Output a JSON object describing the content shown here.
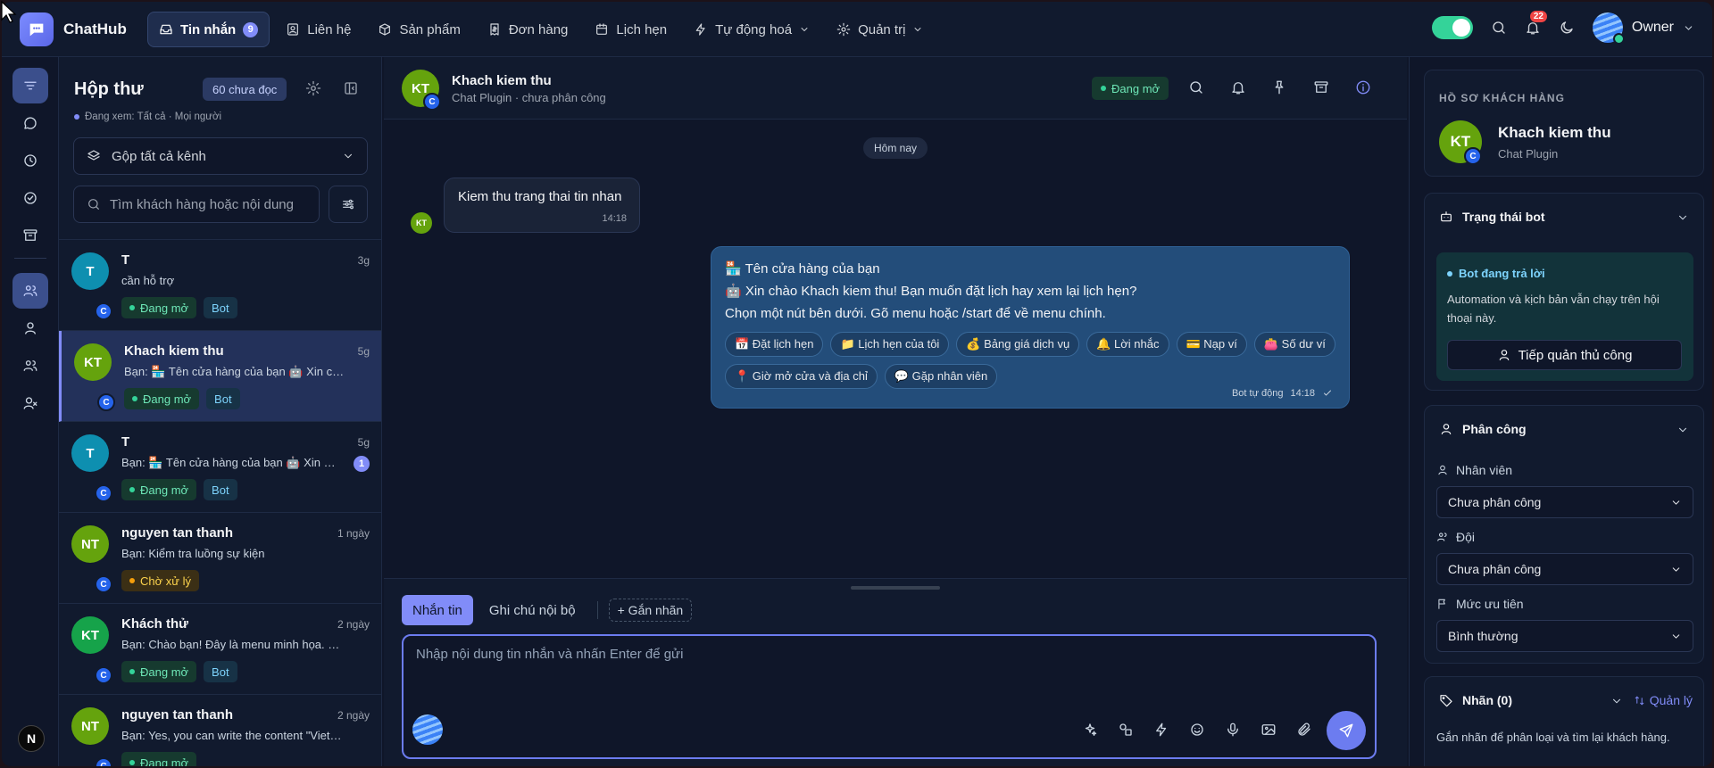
{
  "app": {
    "brand": "ChatHub"
  },
  "nav": {
    "items": [
      {
        "label": "Tin nhắn",
        "badge": "9",
        "active": true
      },
      {
        "label": "Liên hệ"
      },
      {
        "label": "Sản phẩm"
      },
      {
        "label": "Đơn hàng"
      },
      {
        "label": "Lịch hẹn"
      },
      {
        "label": "Tự động hoá"
      },
      {
        "label": "Quản trị"
      }
    ],
    "notifications": "22",
    "user": "Owner"
  },
  "rail": {
    "avatar_letter": "N"
  },
  "inbox": {
    "title": "Hộp thư",
    "unread": "60 chưa đọc",
    "viewing": "Đang xem: Tất cả · Mọi người",
    "channel": "Gộp tất cả kênh",
    "search_placeholder": "Tìm khách hàng hoặc nội dung",
    "conversations": [
      {
        "initials": "T",
        "name": "T",
        "time": "3g",
        "preview": "cần hỗ trợ",
        "status": "Đang mở",
        "bot": "Bot",
        "channel": "C",
        "color": "#0e8fb0"
      },
      {
        "initials": "KT",
        "name": "Khach kiem thu",
        "time": "5g",
        "preview": "Bạn: 🏪 Tên cửa hàng của bạn 🤖 Xin chào Khach kiem thu!",
        "status": "Đang mở",
        "bot": "Bot",
        "channel": "C",
        "color": "#65a30d"
      },
      {
        "initials": "T",
        "name": "T",
        "time": "5g",
        "preview": "Bạn: 🏪 Tên cửa hàng của bạn 🤖 Xin chào T!",
        "status": "Đang mở",
        "bot": "Bot",
        "channel": "C",
        "unread": "1",
        "color": "#0e8fb0"
      },
      {
        "initials": "NT",
        "name": "nguyen tan thanh",
        "time": "1 ngày",
        "preview": "Bạn: Kiểm tra luồng sự kiện",
        "status": "Chờ xử lý",
        "channel": "C",
        "color": "#65a30d"
      },
      {
        "initials": "KT",
        "name": "Khách thử",
        "time": "2 ngày",
        "preview": "Bạn: Chào bạn! Đây là menu minh họa. Bạn muốn xem gì?",
        "status": "Đang mở",
        "bot": "Bot",
        "channel": "C",
        "color": "#16a34a"
      },
      {
        "initials": "NT",
        "name": "nguyen tan thanh",
        "time": "2 ngày",
        "preview": "Bạn: Yes, you can write the content \"Vietnamese\"",
        "status": "Đang mở",
        "channel": "C",
        "color": "#65a30d"
      }
    ]
  },
  "chat": {
    "name": "Khach kiem thu",
    "initials": "KT",
    "channel": "C",
    "subtitle": "Chat Plugin · chưa phân công",
    "status": "Đang mở",
    "day": "Hôm nay",
    "incoming": {
      "text": "Kiem thu trang thai tin nhan",
      "time": "14:18",
      "initials": "KT"
    },
    "outgoing": {
      "lines": [
        "🏪 Tên cửa hàng của bạn",
        "🤖 Xin chào Khach kiem thu! Bạn muốn đặt lịch hay xem lại lịch hẹn?",
        "Chọn một nút bên dưới. Gõ menu hoặc /start để về menu chính."
      ],
      "buttons": [
        "📅 Đặt lịch hẹn",
        "📁 Lịch hẹn của tôi",
        "💰 Bảng giá dịch vụ",
        "🔔 Lời nhắc",
        "💳 Nạp ví",
        "👛 Số dư ví",
        "📍 Giờ mở cửa và địa chỉ",
        "💬 Gặp nhân viên"
      ],
      "sender": "Bot tự động",
      "time": "14:18"
    },
    "composer": {
      "tabs": [
        "Nhắn tin",
        "Ghi chú nội bộ"
      ],
      "label_tab": "+ Gắn nhãn",
      "placeholder": "Nhập nội dung tin nhắn và nhấn Enter để gửi"
    }
  },
  "profile": {
    "section": "HỒ SƠ KHÁCH HÀNG",
    "initials": "KT",
    "channel": "C",
    "name": "Khach kiem thu",
    "source": "Chat Plugin"
  },
  "bot": {
    "title": "Trạng thái bot",
    "status": "Bot đang trả lời",
    "desc": "Automation và kịch bản vẫn chạy trên hội thoại này.",
    "takeover": "Tiếp quản thủ công"
  },
  "assign": {
    "title": "Phân công",
    "agent_label": "Nhân viên",
    "agent_value": "Chưa phân công",
    "team_label": "Đội",
    "team_value": "Chưa phân công",
    "priority_label": "Mức ưu tiên",
    "priority_value": "Bình thường"
  },
  "labels": {
    "title": "Nhãn (0)",
    "manage": "Quản lý",
    "desc": "Gắn nhãn để phân loại và tìm lại khách hàng."
  },
  "colors": {
    "accent": "#818cf8",
    "bg": "#0f1629",
    "panel": "#111a2e",
    "success": "#34d399",
    "outgoing": "#234d7a"
  }
}
